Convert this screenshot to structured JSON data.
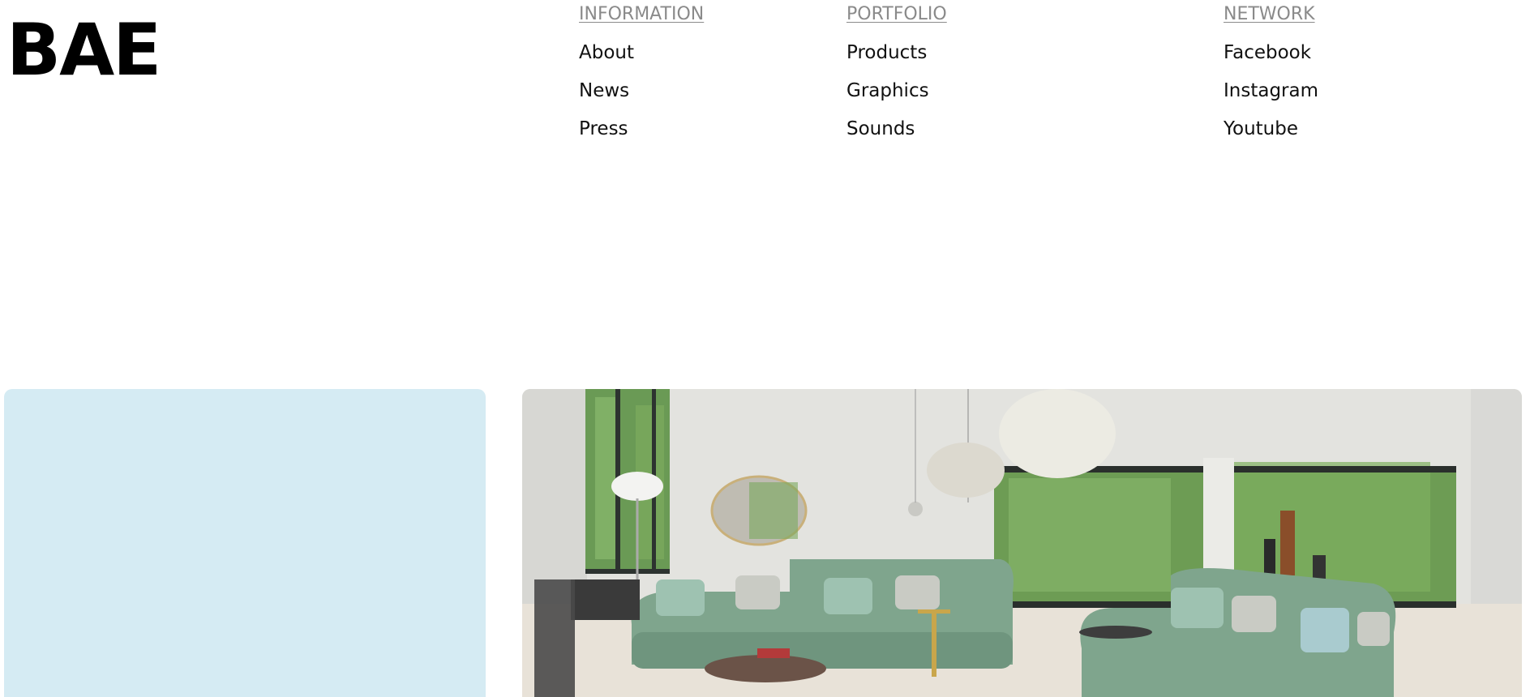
{
  "header": {
    "logo_text": "BAE"
  },
  "nav": {
    "information": {
      "heading": "INFORMATION",
      "links": [
        "About",
        "News",
        "Press"
      ]
    },
    "portfolio": {
      "heading": "PORTFOLIO",
      "links": [
        "Products",
        "Graphics",
        "Sounds"
      ]
    },
    "network": {
      "heading": "NETWORK",
      "links": [
        "Facebook",
        "Instagram",
        "Youtube"
      ]
    }
  },
  "cards": {
    "left": {
      "color": "#d5ebf3"
    },
    "right": {
      "image": "living-room-green-sofa-photo"
    }
  },
  "colors": {
    "heading_gray": "#8a8a8a",
    "text": "#111111",
    "card_blue": "#d5ebf3",
    "sofa_green": "#7fa58d"
  }
}
